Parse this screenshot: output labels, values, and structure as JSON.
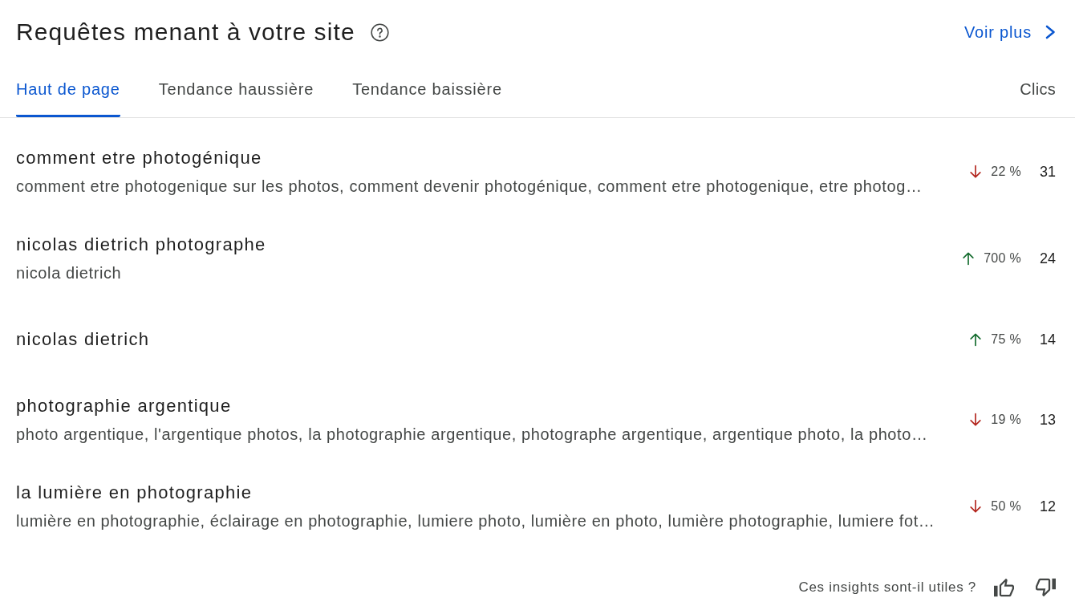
{
  "header": {
    "title": "Requêtes menant à votre site",
    "see_more": "Voir plus"
  },
  "tabs": [
    {
      "label": "Haut de page",
      "selected": true
    },
    {
      "label": "Tendance haussière",
      "selected": false
    },
    {
      "label": "Tendance baissière",
      "selected": false
    }
  ],
  "column_header": "Clics",
  "rows": [
    {
      "query": "comment etre photogénique",
      "variants": "comment etre photogenique sur les photos, comment devenir photogénique, comment etre photogenique, etre photog…",
      "rising": false,
      "change": "22 %",
      "clicks": "31"
    },
    {
      "query": "nicolas dietrich photographe",
      "variants": "nicola dietrich",
      "rising": true,
      "change": "700 %",
      "clicks": "24"
    },
    {
      "query": "nicolas dietrich",
      "rising": true,
      "change": "75 %",
      "clicks": "14"
    },
    {
      "query": "photographie argentique",
      "variants": "photo argentique, l'argentique photos, la photographie argentique, photographe argentique, argentique photo, la photo…",
      "rising": false,
      "change": "19 %",
      "clicks": "13"
    },
    {
      "query": "la lumière en photographie",
      "variants": "lumière en photographie, éclairage en photographie, lumiere photo, lumière en photo, lumière photographie, lumiere fot…",
      "rising": false,
      "change": "50 %",
      "clicks": "12"
    }
  ],
  "feedback": {
    "question": "Ces insights sont-il utiles ?"
  }
}
